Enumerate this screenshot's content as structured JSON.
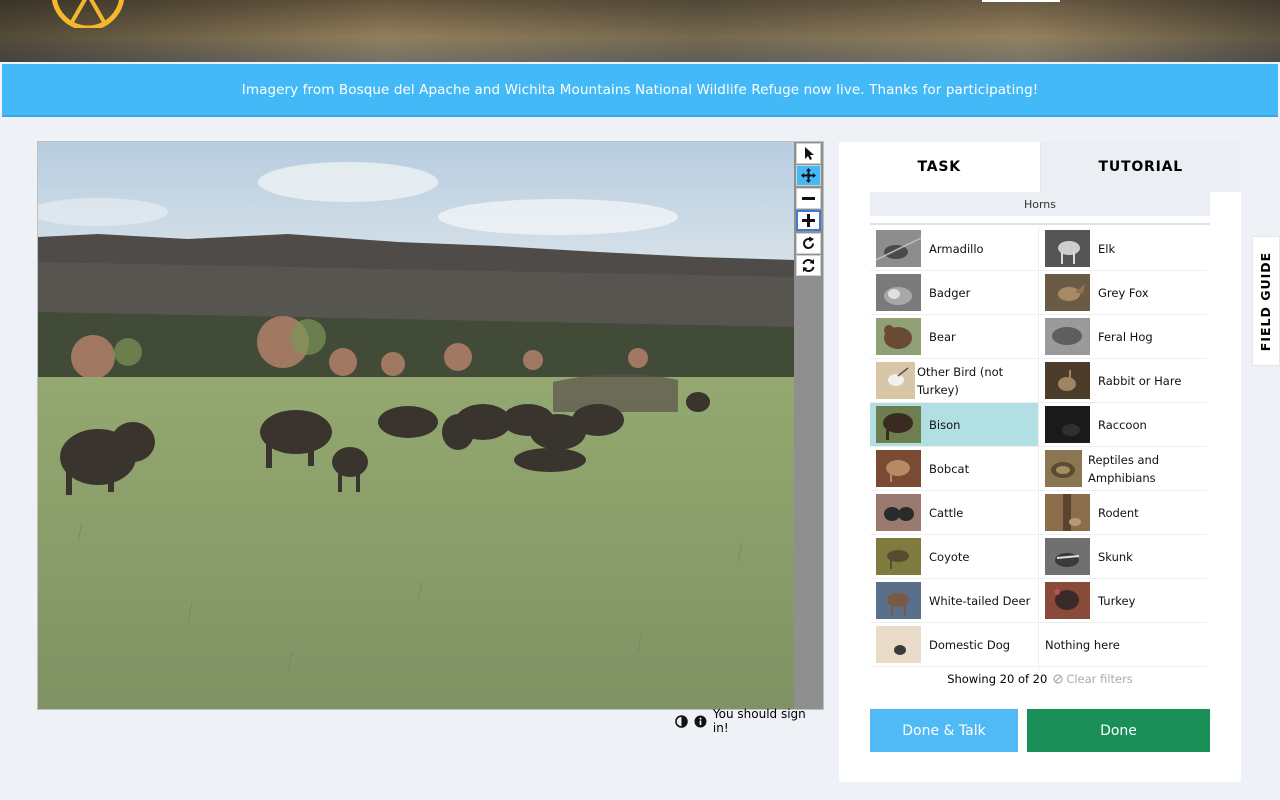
{
  "announcement": "Imagery from Bosque del Apache and Wichita Mountains National Wildlife Refuge now live. Thanks for participating!",
  "toolbar": {
    "tools": [
      "pointer-icon",
      "move-icon",
      "zoom-out-icon",
      "zoom-in-icon",
      "rotate-icon",
      "reset-icon"
    ],
    "active_tool": "move-icon"
  },
  "viewer_footer": {
    "sign_in_text": "You should sign in!"
  },
  "tabs": {
    "task": "TASK",
    "tutorial": "TUTORIAL"
  },
  "filter": {
    "label": "Horns"
  },
  "species": [
    {
      "name": "Armadillo",
      "selected": false
    },
    {
      "name": "Elk",
      "selected": false
    },
    {
      "name": "Badger",
      "selected": false
    },
    {
      "name": "Grey Fox",
      "selected": false
    },
    {
      "name": "Bear",
      "selected": false
    },
    {
      "name": "Feral Hog",
      "selected": false
    },
    {
      "name": "Other Bird (not Turkey)",
      "selected": false
    },
    {
      "name": "Rabbit or Hare",
      "selected": false
    },
    {
      "name": "Bison",
      "selected": true
    },
    {
      "name": "Raccoon",
      "selected": false
    },
    {
      "name": "Bobcat",
      "selected": false
    },
    {
      "name": "Reptiles and Amphibians",
      "selected": false
    },
    {
      "name": "Cattle",
      "selected": false
    },
    {
      "name": "Rodent",
      "selected": false
    },
    {
      "name": "Coyote",
      "selected": false
    },
    {
      "name": "Skunk",
      "selected": false
    },
    {
      "name": "White-tailed Deer",
      "selected": false
    },
    {
      "name": "Turkey",
      "selected": false
    },
    {
      "name": "Domestic Dog",
      "selected": false
    },
    {
      "name": "Nothing here",
      "selected": false
    }
  ],
  "showing_text": "Showing 20 of 20",
  "clear_filters": "Clear filters",
  "buttons": {
    "done_talk": "Done & Talk",
    "done": "Done"
  },
  "field_guide": "FIELD GUIDE",
  "colors": {
    "accent": "#43b9f8",
    "done": "#1a8f57",
    "selected": "#b1dfe3"
  }
}
